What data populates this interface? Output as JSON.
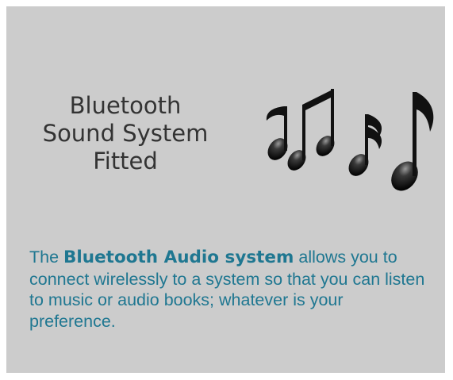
{
  "title": {
    "line1": "Bluetooth",
    "line2": "Sound System",
    "line3": "Fitted"
  },
  "description": {
    "before": "The ",
    "emphasis": "Bluetooth Audio system",
    "after": " allows you to connect wirelessly to a system so that you can listen to music or audio books; whatever is your preference."
  },
  "colors": {
    "panel_background": "#cccccc",
    "title_text": "#333333",
    "description_text": "#1f7791"
  },
  "icons": {
    "notes": "music-notes-icon"
  }
}
